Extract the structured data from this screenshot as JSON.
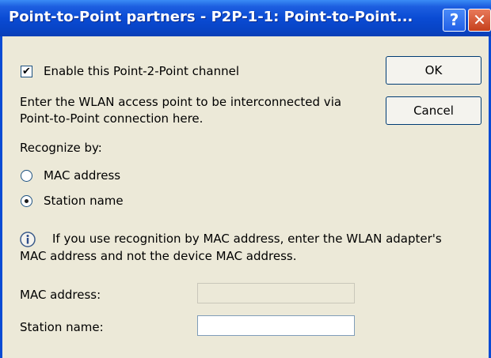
{
  "window": {
    "title": "Point-to-Point partners - P2P-1-1: Point-to-Point...",
    "help_glyph": "?",
    "close_glyph": "✕"
  },
  "enable_channel": {
    "label": "Enable this Point-2-Point channel",
    "checked": true,
    "check_glyph": "✔"
  },
  "buttons": {
    "ok": "OK",
    "cancel": "Cancel"
  },
  "instructions": {
    "line1": "Enter the WLAN access point to be interconnected via",
    "line2": "Point-to-Point connection here."
  },
  "recognize": {
    "heading": "Recognize by:",
    "options": [
      {
        "label": "MAC address",
        "selected": false
      },
      {
        "label": "Station name",
        "selected": true
      }
    ]
  },
  "info": {
    "line1": "If you use recognition by MAC address, enter the WLAN adapter's",
    "line2": "MAC address and not the device MAC address."
  },
  "fields": {
    "mac_label": "MAC address:",
    "mac_value": "",
    "station_label": "Station name:",
    "station_value": ""
  },
  "colors": {
    "titlebar": "#0a4bd4",
    "dialog_bg": "#ece9d8",
    "close_button": "#c6401c"
  }
}
